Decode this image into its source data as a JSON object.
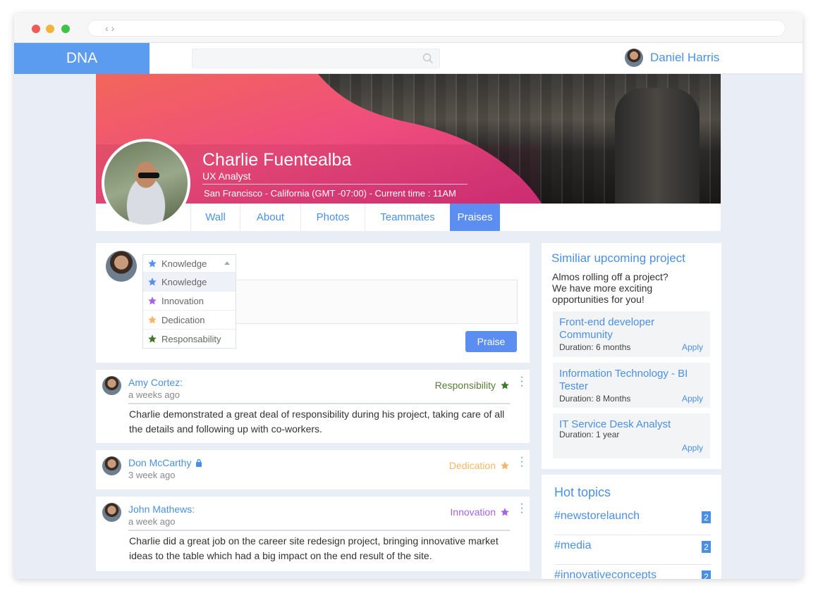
{
  "app": {
    "logo": "DNA",
    "user_name": "Daniel Harris"
  },
  "search": {
    "placeholder": ""
  },
  "profile": {
    "name": "Charlie Fuentealba",
    "role": "UX Analyst",
    "location": "San Francisco - California (GMT -07:00) - Current time : 11AM"
  },
  "tabs": [
    {
      "label": "Wall"
    },
    {
      "label": "About"
    },
    {
      "label": "Photos"
    },
    {
      "label": "Teammates"
    },
    {
      "label": "Praises",
      "active": true
    }
  ],
  "compose": {
    "selected": "Knowledge",
    "options": [
      {
        "label": "Knowledge",
        "color": "#5b8ef0"
      },
      {
        "label": "Innovation",
        "color": "#a564e8"
      },
      {
        "label": "Dedication",
        "color": "#f5b66a"
      },
      {
        "label": "Responsability",
        "color": "#3f7a26"
      }
    ],
    "button": "Praise"
  },
  "posts": [
    {
      "author": "Amy Cortez:",
      "time": "a weeks ago",
      "category": "Responsibility",
      "category_color": "#5a7a3a",
      "star_color": "#3f7a26",
      "body": "Charlie demonstrated a great deal of responsibility during his project, taking care of all the details and following up with co-workers."
    },
    {
      "author": "Don McCarthy",
      "time": "3 week ago",
      "category": "Dedication",
      "category_color": "#f5b66a",
      "star_color": "#f5b66a",
      "locked": true,
      "body": ""
    },
    {
      "author": "John Mathews:",
      "time": "a week ago",
      "category": "Innovation",
      "category_color": "#a564e8",
      "star_color": "#a564e8",
      "body": "Charlie did a great job on the career site redesign project, bringing innovative market ideas to the table which had a big impact on the end result of the site."
    }
  ],
  "upcoming": {
    "title": "Similiar upcoming project",
    "intro": "Almos rolling off a project? We have more exciting opportunities for you!",
    "projects": [
      {
        "title": "Front-end developer Community",
        "duration": "Duration: 6 months",
        "apply": "Apply"
      },
      {
        "title": "Information Technology - BI Tester",
        "duration": "Duration: 8 Months",
        "apply": "Apply"
      },
      {
        "title": "IT Service Desk Analyst",
        "duration": "Duration: 1 year",
        "apply": "Apply"
      }
    ]
  },
  "hot_topics": {
    "title": "Hot topics",
    "items": [
      {
        "tag": "#newstorelaunch",
        "count": "2"
      },
      {
        "tag": "#media",
        "count": "2"
      },
      {
        "tag": "#innovativeconcepts",
        "count": "2"
      }
    ]
  }
}
